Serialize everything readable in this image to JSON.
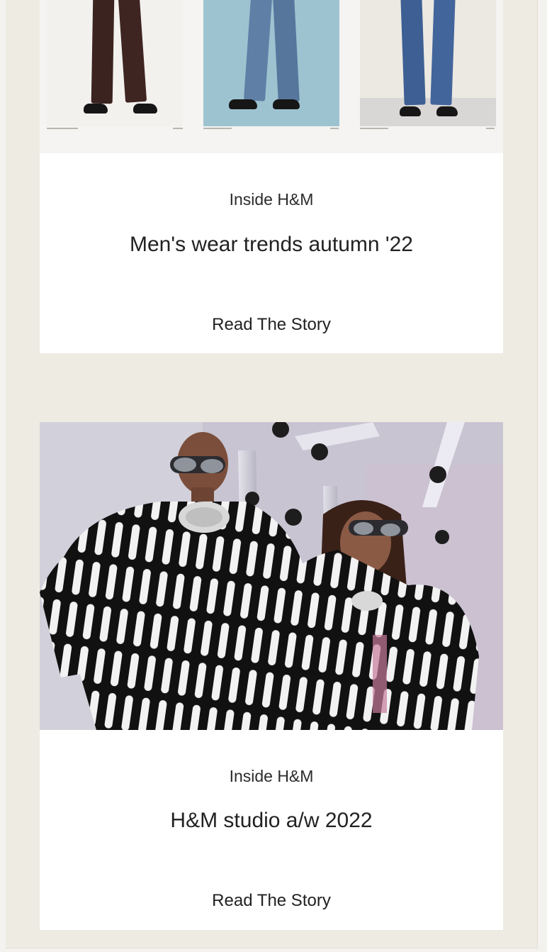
{
  "stories": [
    {
      "category": "Inside H&M",
      "title": "Men's wear trends autumn '22",
      "cta": "Read The Story",
      "image_alt": "Three lookbook photos of trousers: brown trousers on cream, light blue jeans on blue, blue denim on cream"
    },
    {
      "category": "Inside H&M",
      "title": "H&M studio a/w 2022",
      "cta": "Read The Story",
      "image_alt": "Two models wearing black and white patterned sweaters and silver sunglasses in a studio"
    }
  ],
  "colors": {
    "page_background": "#eeebe2",
    "card_background": "#ffffff",
    "text": "#222222"
  }
}
